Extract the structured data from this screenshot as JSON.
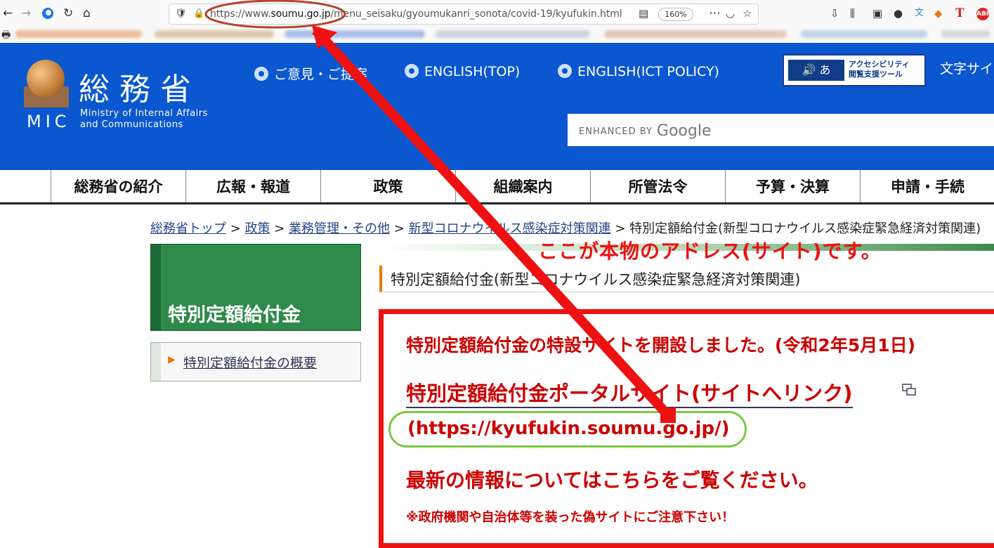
{
  "browser": {
    "url_prefix": "https://www.",
    "url_domain": "soumu.go.jp",
    "url_path": "/menu_seisaku/gyoumukanri_sonota/covid-19/kyufukin.html",
    "zoom": "160%",
    "icons": [
      "back-icon",
      "forward-icon",
      "refresh-icon",
      "home-icon",
      "shield-icon",
      "lock-icon",
      "reader-icon",
      "more-icon",
      "pocket-icon",
      "star-icon",
      "library-icon",
      "sidebar-icon",
      "account-icon",
      "abp-icon"
    ],
    "abp_label": "ABP",
    "t_label": "T"
  },
  "header": {
    "org_name": "総務省",
    "org_abbr": "MIC",
    "org_en_line1": "Ministry of Internal Affairs",
    "org_en_line2": "and Communications",
    "links": [
      "ご意見・ご提案",
      "ENGLISH(TOP)",
      "ENGLISH(ICT POLICY)"
    ],
    "access_icons": "🔊 あ",
    "access_line1": "アクセシビリティ",
    "access_line2": "閲覧支援ツール",
    "fontsize": "文字サイ",
    "search_label": "ENHANCED BY",
    "search_brand": "Google"
  },
  "nav": [
    "総務省の紹介",
    "広報・報道",
    "政策",
    "組織案内",
    "所管法令",
    "予算・決算",
    "申請・手続"
  ],
  "breadcrumb": {
    "items": [
      "総務省トップ",
      "政策",
      "業務管理・その他",
      "新型コロナウイルス感染症対策関連"
    ],
    "current": "特別定額給付金(新型コロナウイルス感染症緊急経済対策関連)"
  },
  "sidebar": {
    "title": "特別定額給付金",
    "link": "特別定額給付金の概要"
  },
  "content": {
    "page_title": "特別定額給付金(新型コロナウイルス感染症緊急経済対策関連)",
    "line1": "特別定額給付金の特設サイトを開設しました。(令和2年5月1日)",
    "portal_link": "特別定額給付金ポータルサイト(サイトへリンク)",
    "portal_url": "(https://kyufukin.soumu.go.jp/)",
    "latest": "最新の情報についてはこちらをご覧ください。",
    "warning": "※政府機関や自治体等を装った偽サイトにご注意下さい！"
  },
  "annotation": {
    "callout": "ここが本物のアドレス(サイト)です。",
    "colors": {
      "arrow": "#ee1111",
      "url_circle": "#b5432b",
      "link_circle": "#7ac943"
    }
  },
  "colors": {
    "header_bg": "#0a57d0",
    "green": "#2e8a4a",
    "accent_orange": "#ee7700",
    "alert_red": "#cc0000"
  }
}
